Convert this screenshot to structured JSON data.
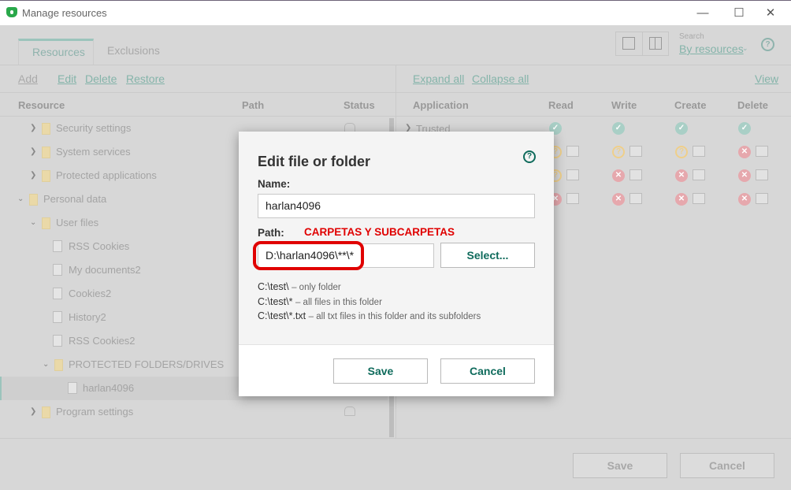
{
  "window": {
    "title": "Manage resources",
    "minimize": "—",
    "maximize": "☐",
    "close": "✕"
  },
  "tabs": [
    {
      "label": "Resources"
    },
    {
      "label": "Exclusions"
    }
  ],
  "search": {
    "label": "Search",
    "value": "By resources"
  },
  "left_toolbar": {
    "add": "Add",
    "edit": "Edit",
    "delete": "Delete",
    "restore": "Restore"
  },
  "right_toolbar": {
    "expand": "Expand all",
    "collapse": "Collapse all",
    "view": "View"
  },
  "left_columns": [
    "Resource",
    "Path",
    "Status"
  ],
  "right_columns": [
    "Application",
    "Read",
    "Write",
    "Create",
    "Delete"
  ],
  "tree": [
    {
      "label": "Security settings"
    },
    {
      "label": "System services"
    },
    {
      "label": "Protected applications"
    },
    {
      "label": "Personal data"
    },
    {
      "label": "User files"
    },
    {
      "label": "RSS Cookies"
    },
    {
      "label": "My documents2"
    },
    {
      "label": "Cookies2"
    },
    {
      "label": "History2"
    },
    {
      "label": "RSS Cookies2"
    },
    {
      "label": "PROTECTED FOLDERS/DRIVES"
    },
    {
      "label": "harlan4096"
    },
    {
      "label": "Program settings"
    }
  ],
  "apps": [
    {
      "label": "Trusted",
      "perms": [
        "allow",
        "allow",
        "allow",
        "allow"
      ]
    },
    {
      "label": "",
      "perms": [
        "ask",
        "ask",
        "ask",
        "deny"
      ]
    },
    {
      "label": "",
      "perms": [
        "ask",
        "deny",
        "deny",
        "deny"
      ]
    },
    {
      "label": "",
      "perms": [
        "deny",
        "deny",
        "deny",
        "deny"
      ]
    }
  ],
  "dialog": {
    "title": "Edit file or folder",
    "name_label": "Name:",
    "name_value": "harlan4096",
    "path_label": "Path:",
    "annotation": "CARPETAS Y SUBCARPETAS",
    "path_value": "D:\\harlan4096\\**\\*",
    "select": "Select...",
    "hints": [
      {
        "code": "C:\\test\\",
        "desc": "– only folder"
      },
      {
        "code": "C:\\test\\*",
        "desc": "– all files in this folder"
      },
      {
        "code": "C:\\test\\*.txt",
        "desc": "– all txt files in this folder and its subfolders"
      }
    ],
    "save": "Save",
    "cancel": "Cancel"
  },
  "bottom": {
    "save": "Save",
    "cancel": "Cancel"
  },
  "colors": {
    "accent": "#0f6b5c",
    "annotation": "#e00000"
  }
}
